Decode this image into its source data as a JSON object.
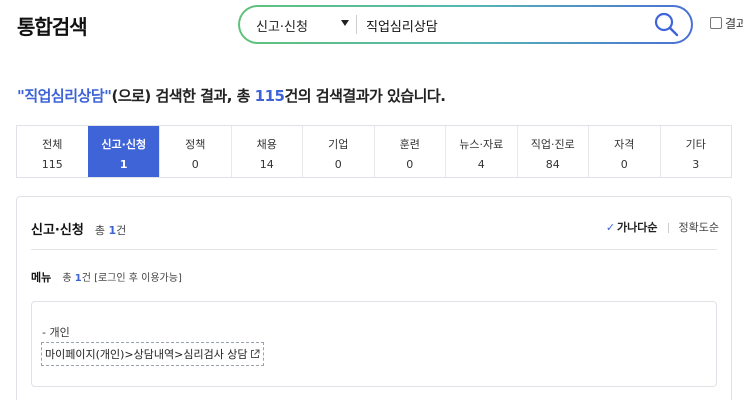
{
  "header": {
    "title": "통합검색",
    "search": {
      "category": "신고·신청",
      "query": "직업심리상담",
      "placeholder": ""
    },
    "checkbox_label": "결과"
  },
  "summary": {
    "quote_open": "\"",
    "keyword": "직업심리상담",
    "quote_close": "\"",
    "mid": "(으로) 검색한 결과, 총 ",
    "total": "115",
    "tail": "건의 검색결과가 있습니다."
  },
  "tabs": [
    {
      "label": "전체",
      "count": "115"
    },
    {
      "label": "신고·신청",
      "count": "1"
    },
    {
      "label": "정책",
      "count": "0"
    },
    {
      "label": "채용",
      "count": "14"
    },
    {
      "label": "기업",
      "count": "0"
    },
    {
      "label": "훈련",
      "count": "0"
    },
    {
      "label": "뉴스·자료",
      "count": "4"
    },
    {
      "label": "직업·진로",
      "count": "84"
    },
    {
      "label": "자격",
      "count": "0"
    },
    {
      "label": "기타",
      "count": "3"
    }
  ],
  "section": {
    "title": "신고·신청",
    "total_prefix": "총 ",
    "total_num": "1",
    "total_suffix": "건",
    "sort_active": "가나다순",
    "sort_other": "정확도순",
    "menu": {
      "title": "메뉴",
      "count_prefix": "총 ",
      "count_num": "1",
      "count_suffix": "건 [로그인 후 이용가능]"
    },
    "result": {
      "category": "- 개인",
      "path": "마이페이지(개인)>상담내역>심리검사 상담"
    }
  },
  "colors": {
    "accent": "#3f64d8",
    "highlight_text": "#3d63d6"
  }
}
